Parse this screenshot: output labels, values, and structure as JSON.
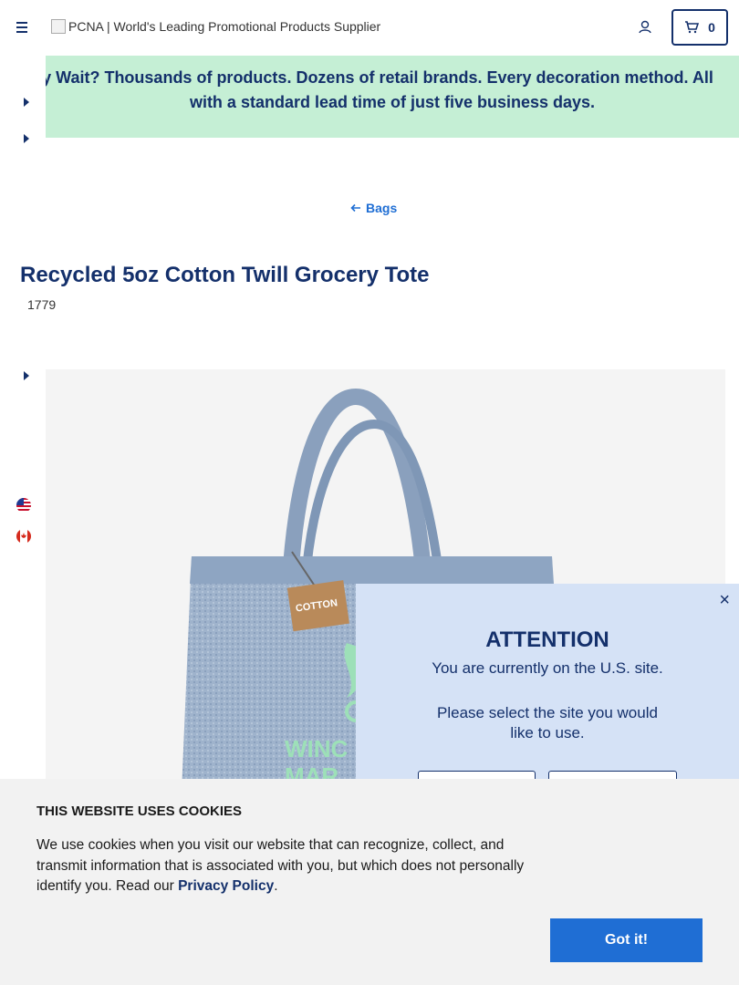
{
  "header": {
    "logo_alt": "PCNA | World's Leading Promotional Products Supplier",
    "cart_count": "0"
  },
  "banner": {
    "line1": "Why Wait? Thousands of products. Dozens of retail brands. Every decoration method. All",
    "line2": "with a standard lead time of just five business days."
  },
  "breadcrumb": {
    "label": "Bags"
  },
  "product": {
    "title": "Recycled 5oz Cotton Twill Grocery Tote",
    "sku": "1779"
  },
  "image": {
    "print_text_1": "WINC",
    "print_text_2": "MAR"
  },
  "attention": {
    "title": "ATTENTION",
    "line1": "You are currently on the U.S. site.",
    "line2": "Please select the site you would",
    "line3": "like to use.",
    "close": "×"
  },
  "cookie": {
    "title": "THIS WEBSITE USES COOKIES",
    "text": "We use cookies when you visit our website that can recognize, collect, and transmit information that is associated with you, but which does not personally identify you. Read our ",
    "link": "Privacy Policy",
    "period": ".",
    "button": "Got it!"
  },
  "colors": {
    "navy": "#14306b",
    "blue": "#1f6ed4",
    "banner_bg": "#c5efd5",
    "modal_bg": "#d5e2f6"
  }
}
